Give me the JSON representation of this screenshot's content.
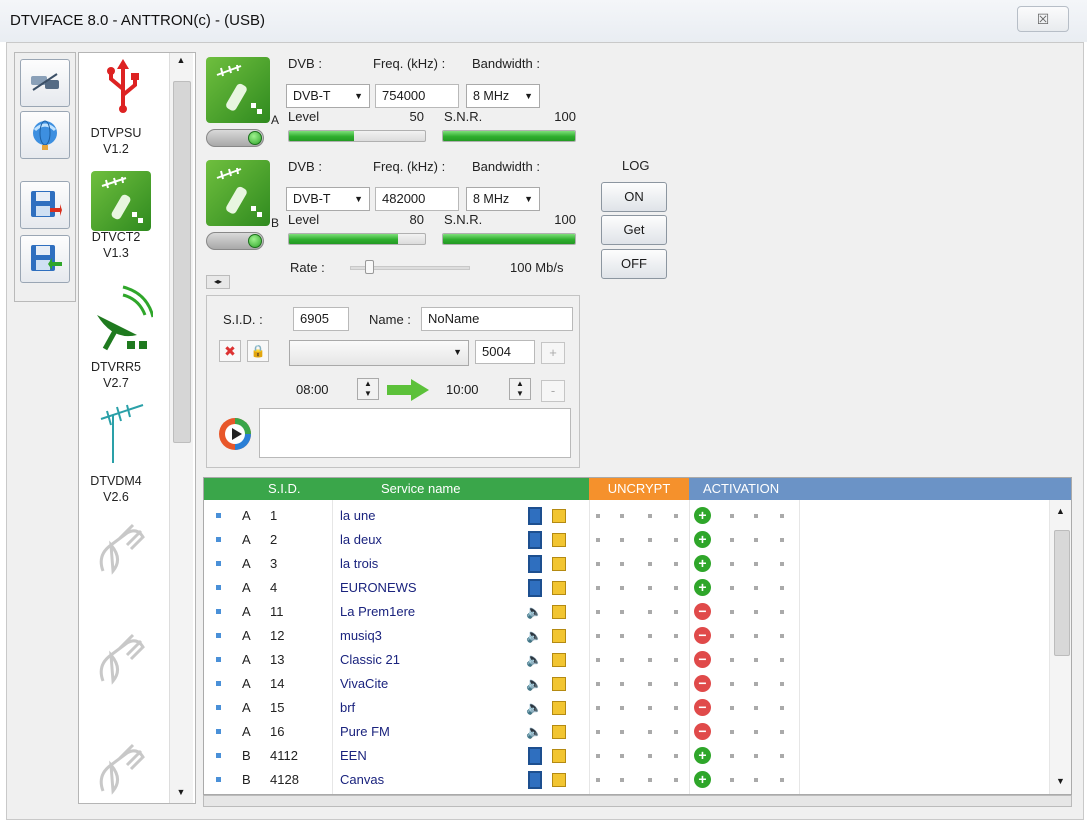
{
  "window": {
    "title": "DTVIFACE 8.0 - ANTTRON(c) - (USB)",
    "close_symbol": "☒"
  },
  "devices": [
    {
      "name": "DTVPSU",
      "version": "V1.2"
    },
    {
      "name": "DTVCT2",
      "version": "V1.3"
    },
    {
      "name": "DTVRR5",
      "version": "V2.7"
    },
    {
      "name": "DTVDM4",
      "version": "V2.6"
    }
  ],
  "tuner_a": {
    "dvb_label": "DVB :",
    "freq_label": "Freq. (kHz) :",
    "bw_label": "Bandwidth :",
    "dvb": "DVB-T",
    "freq": "754000",
    "bandwidth": "8 MHz",
    "port": "A",
    "level_label": "Level",
    "level": "50",
    "snr_label": "S.N.R.",
    "snr": "100"
  },
  "tuner_b": {
    "dvb_label": "DVB :",
    "freq_label": "Freq. (kHz) :",
    "bw_label": "Bandwidth :",
    "dvb": "DVB-T",
    "freq": "482000",
    "bandwidth": "8 MHz",
    "port": "B",
    "level_label": "Level",
    "level": "80",
    "snr_label": "S.N.R.",
    "snr": "100"
  },
  "rate": {
    "label": "Rate :",
    "value": "100 Mb/s"
  },
  "log": {
    "label": "LOG",
    "on": "ON",
    "get": "Get",
    "off": "OFF"
  },
  "service_edit": {
    "sid_label": "S.I.D. :",
    "sid": "6905",
    "name_label": "Name :",
    "name": "NoName",
    "pid": "5004",
    "plus": "+",
    "minus": "-",
    "time_start": "08:00",
    "time_end": "10:00"
  },
  "table": {
    "headers": {
      "sid": "S.I.D.",
      "service": "Service name",
      "uncrypt": "UNCRYPT",
      "activation": "ACTIVATION"
    },
    "rows": [
      {
        "port": "A",
        "sid": "1",
        "name": "la une",
        "kind": "tv",
        "active": "on"
      },
      {
        "port": "A",
        "sid": "2",
        "name": "la deux",
        "kind": "tv",
        "active": "on"
      },
      {
        "port": "A",
        "sid": "3",
        "name": "la trois",
        "kind": "tv",
        "active": "on"
      },
      {
        "port": "A",
        "sid": "4",
        "name": "EURONEWS",
        "kind": "tv",
        "active": "on"
      },
      {
        "port": "A",
        "sid": "11",
        "name": "La Prem1ere",
        "kind": "radio",
        "active": "off"
      },
      {
        "port": "A",
        "sid": "12",
        "name": "musiq3",
        "kind": "radio",
        "active": "off"
      },
      {
        "port": "A",
        "sid": "13",
        "name": "Classic 21",
        "kind": "radio",
        "active": "off"
      },
      {
        "port": "A",
        "sid": "14",
        "name": "VivaCite",
        "kind": "radio",
        "active": "off"
      },
      {
        "port": "A",
        "sid": "15",
        "name": "brf",
        "kind": "radio",
        "active": "off"
      },
      {
        "port": "A",
        "sid": "16",
        "name": "Pure FM",
        "kind": "radio",
        "active": "off"
      },
      {
        "port": "B",
        "sid": "4112",
        "name": "EEN",
        "kind": "tv",
        "active": "on"
      },
      {
        "port": "B",
        "sid": "4128",
        "name": "Canvas",
        "kind": "tv",
        "active": "on"
      }
    ]
  },
  "colors": {
    "green": "#3aa64a",
    "orange": "#f5912c",
    "blue": "#6b93c6"
  }
}
